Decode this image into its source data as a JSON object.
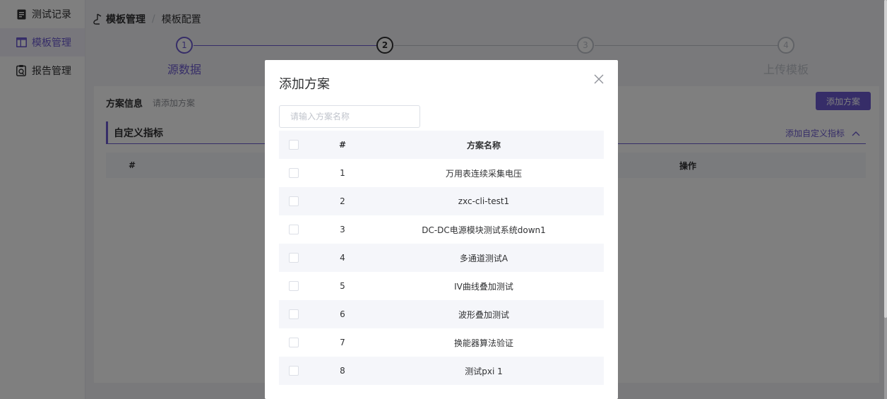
{
  "sidebar": {
    "items": [
      {
        "label": "测试记录",
        "icon": "document-icon",
        "active": false
      },
      {
        "label": "模板管理",
        "icon": "template-icon",
        "active": true
      },
      {
        "label": "报告管理",
        "icon": "report-icon",
        "active": false
      }
    ]
  },
  "breadcrumb": {
    "root": "模板管理",
    "current": "模板配置",
    "separator": "/"
  },
  "steps": [
    {
      "number": "1",
      "title": "源数据",
      "status": "done"
    },
    {
      "number": "2",
      "title": "",
      "status": "current"
    },
    {
      "number": "3",
      "title": "",
      "status": "wait"
    },
    {
      "number": "4",
      "title": "上传模板",
      "status": "wait"
    }
  ],
  "panel": {
    "plan_label": "方案信息",
    "plan_hint": "请添加方案",
    "add_plan_button": "添加方案",
    "custom_title": "自定义指标",
    "add_custom_link": "添加自定义指标",
    "table_header_index": "#",
    "table_header_operation": "操作"
  },
  "dialog": {
    "title": "添加方案",
    "search_placeholder": "请输入方案名称",
    "columns": {
      "index": "#",
      "name": "方案名称"
    },
    "rows": [
      {
        "index": "1",
        "name": "万用表连续采集电压"
      },
      {
        "index": "2",
        "name": "zxc-cli-test1"
      },
      {
        "index": "3",
        "name": "DC-DC电源模块测试系统down1"
      },
      {
        "index": "4",
        "name": "多通道测试A"
      },
      {
        "index": "5",
        "name": "IV曲线叠加测试"
      },
      {
        "index": "6",
        "name": "波形叠加测试"
      },
      {
        "index": "7",
        "name": "换能器算法验证"
      },
      {
        "index": "8",
        "name": "测试pxi 1"
      }
    ]
  },
  "colors": {
    "accent": "#6d5bd0",
    "active_bg": "#f0eef9",
    "stripe": "#f5f6fa"
  }
}
